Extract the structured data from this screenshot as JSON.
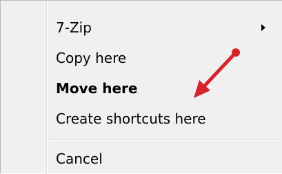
{
  "menu": {
    "items": [
      {
        "label": "7-Zip",
        "has_submenu": true
      },
      {
        "label": "Copy here"
      },
      {
        "label": "Move here",
        "default": true
      },
      {
        "label": "Create shortcuts here"
      }
    ],
    "cancel_label": "Cancel"
  },
  "annotation": {
    "color": "#d8232a"
  }
}
